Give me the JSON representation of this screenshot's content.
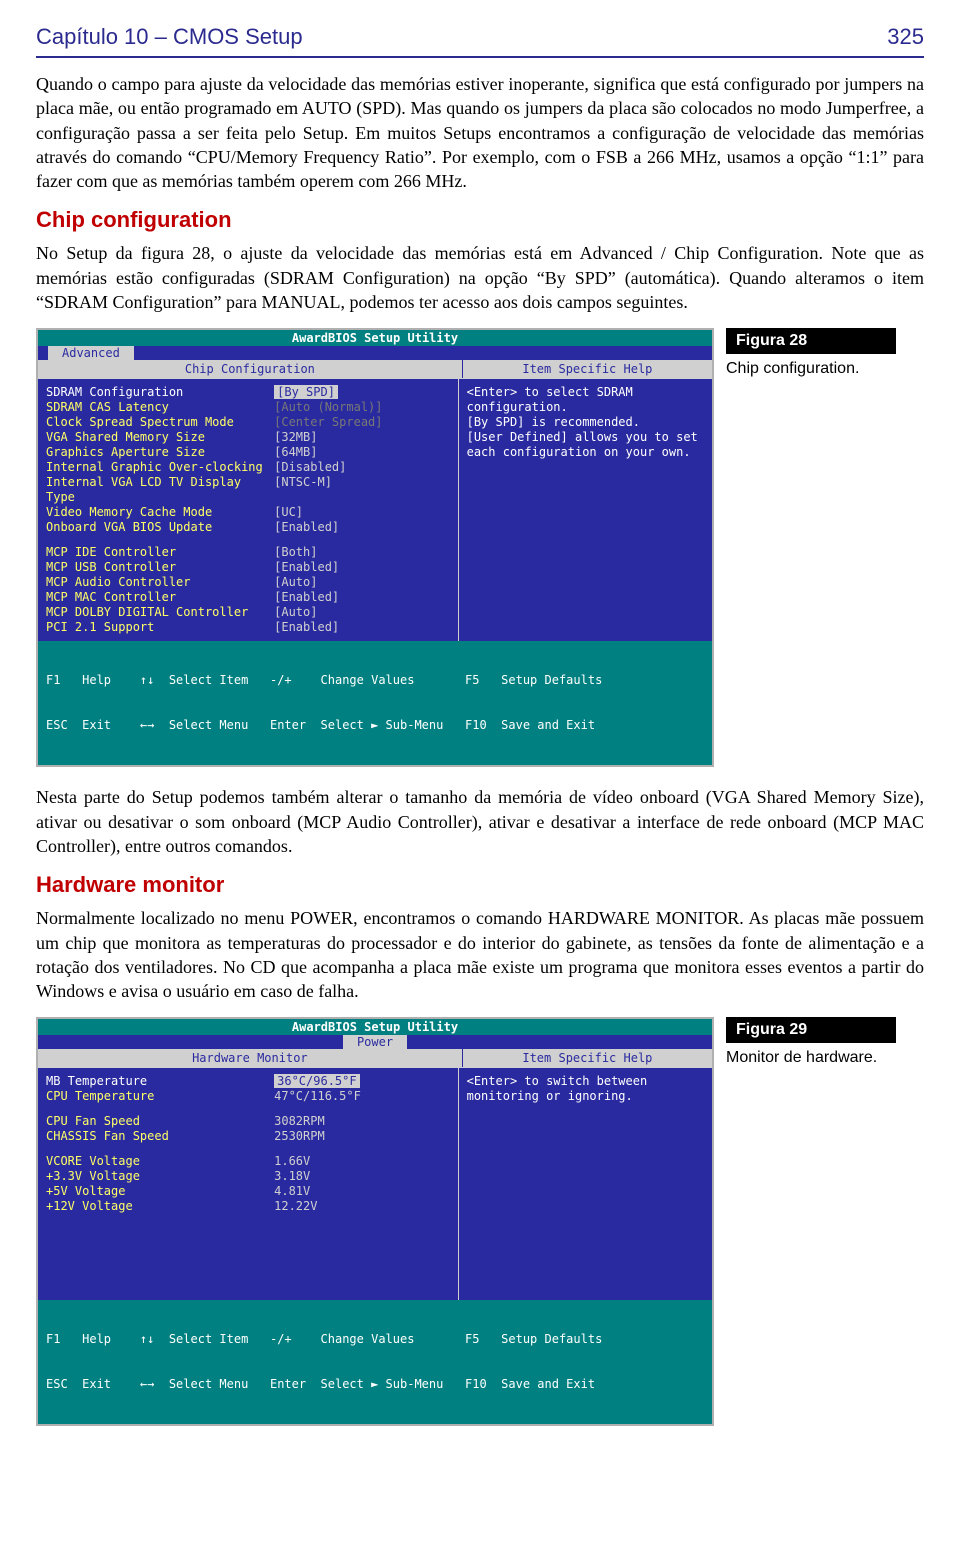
{
  "header": {
    "left": "Capítulo 10 – CMOS Setup",
    "right": "325"
  },
  "para1": "Quando o campo para ajuste da velocidade das memórias estiver inoperante, significa que está configurado por jumpers na placa mãe, ou então programado em AUTO (SPD). Mas quando os jumpers da placa são colocados no modo Jumperfree, a configuração passa a ser feita pelo Setup. Em muitos Setups encontramos a configuração de velocidade das memórias através do comando “CPU/Memory Frequency Ratio”. Por exemplo, com o FSB a 266 MHz, usamos a opção “1:1” para fazer com que as memórias também operem com 266 MHz.",
  "heading1": "Chip configuration",
  "para2": "No Setup da figura 28, o ajuste da velocidade das memórias está em Advanced / Chip Configuration. Note que as memórias estão configuradas (SDRAM Configuration) na opção “By SPD” (automática). Quando alteramos o item “SDRAM Configuration” para MANUAL, podemos ter acesso aos dois campos seguintes.",
  "fig28": {
    "badge": "Figura 28",
    "caption": "Chip configuration."
  },
  "bios28": {
    "title": "AwardBIOS Setup Utility",
    "tab": "Advanced",
    "section": "Chip Configuration",
    "helpTitle": "Item Specific Help",
    "help": "<Enter> to select SDRAM configuration.\n[By SPD] is recommended.\n[User Defined] allows you to set each configuration on your own.",
    "rows1": [
      {
        "l": "SDRAM Configuration",
        "v": "[By SPD]",
        "hl": true
      },
      {
        "l": "SDRAM CAS Latency",
        "v": "[Auto (Normal)]",
        "dim": true
      },
      {
        "l": "Clock Spread Spectrum Mode",
        "v": "[Center Spread]",
        "dim": true
      },
      {
        "l": "VGA Shared Memory Size",
        "v": "[32MB]"
      },
      {
        "l": "Graphics Aperture Size",
        "v": "[64MB]"
      },
      {
        "l": "Internal Graphic Over-clocking",
        "v": "[Disabled]"
      },
      {
        "l": "Internal VGA LCD TV Display Type",
        "v": "[NTSC-M]"
      },
      {
        "l": "Video Memory Cache Mode",
        "v": "[UC]"
      },
      {
        "l": "Onboard VGA BIOS Update",
        "v": "[Enabled]"
      }
    ],
    "rows2": [
      {
        "l": "MCP IDE Controller",
        "v": "[Both]"
      },
      {
        "l": "MCP USB Controller",
        "v": "[Enabled]"
      },
      {
        "l": "MCP Audio Controller",
        "v": "[Auto]"
      },
      {
        "l": "MCP MAC Controller",
        "v": "[Enabled]"
      },
      {
        "l": "MCP DOLBY DIGITAL Controller",
        "v": "[Auto]"
      },
      {
        "l": "PCI 2.1 Support",
        "v": "[Enabled]"
      }
    ],
    "footer1": "F1   Help    ↑↓  Select Item   -/+    Change Values       F5   Setup Defaults",
    "footer2": "ESC  Exit    ←→  Select Menu   Enter  Select ► Sub-Menu   F10  Save and Exit"
  },
  "para3": "Nesta parte do Setup podemos também alterar o tamanho da memória de vídeo onboard (VGA Shared Memory Size), ativar ou desativar o som onboard (MCP Audio Controller), ativar e desativar a interface de rede onboard (MCP MAC Controller), entre outros comandos.",
  "heading2": "Hardware monitor",
  "para4": "Normalmente localizado no menu POWER, encontramos o comando HARDWARE MONITOR. As placas mãe possuem um chip que monitora as temperaturas do processador e do interior do gabinete, as tensões da fonte de alimentação e a rotação dos ventiladores. No CD que acompanha a placa mãe existe um programa que monitora esses eventos a partir do Windows e avisa o usuário em caso de falha.",
  "fig29": {
    "badge": "Figura 29",
    "caption": "Monitor de hardware."
  },
  "bios29": {
    "title": "AwardBIOS Setup Utility",
    "tab": "Power",
    "section": "Hardware Monitor",
    "helpTitle": "Item Specific Help",
    "help": "<Enter> to switch between monitoring or ignoring.",
    "rows1": [
      {
        "l": "MB Temperature",
        "v": "36°C/96.5°F",
        "hl": true
      },
      {
        "l": "CPU Temperature",
        "v": "47°C/116.5°F"
      }
    ],
    "rows2": [
      {
        "l": "CPU Fan Speed",
        "v": "3082RPM"
      },
      {
        "l": "CHASSIS Fan Speed",
        "v": "2530RPM"
      }
    ],
    "rows3": [
      {
        "l": "VCORE Voltage",
        "v": "1.66V"
      },
      {
        "l": "+3.3V Voltage",
        "v": "3.18V"
      },
      {
        "l": "+5V   Voltage",
        "v": "4.81V"
      },
      {
        "l": "+12V  Voltage",
        "v": "12.22V"
      }
    ],
    "footer1": "F1   Help    ↑↓  Select Item   -/+    Change Values       F5   Setup Defaults",
    "footer2": "ESC  Exit    ←→  Select Menu   Enter  Select ► Sub-Menu   F10  Save and Exit"
  }
}
